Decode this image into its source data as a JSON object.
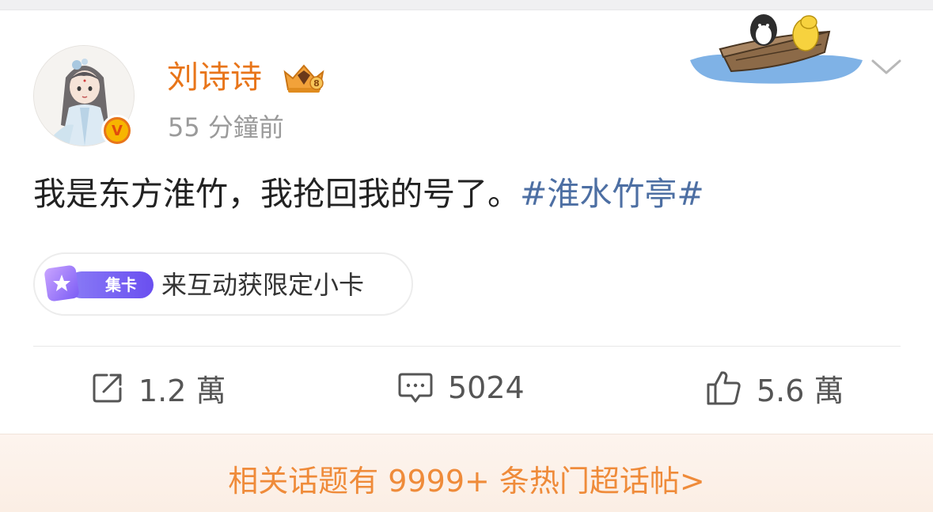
{
  "post": {
    "username": "刘诗诗",
    "time": "55 分鐘前",
    "content_text": "我是东方淮竹，我抢回我的号了。",
    "content_topic": "#淮水竹亭#",
    "verified_badge": "V"
  },
  "promo_pill": {
    "label": "集卡",
    "text": "来互动获限定小卡"
  },
  "actions": {
    "repost_count": "1.2 萬",
    "comment_count": "5024",
    "like_count": "5.6 萬"
  },
  "footer": {
    "text": "相关话题有 9999+ 条热门超话帖>"
  },
  "icons": {
    "repost": "share-box-arrow-icon",
    "comment": "comment-bubble-icon",
    "like": "thumbs-up-icon",
    "more": "chevron-down-icon",
    "crown": "crown-badge-icon"
  },
  "colors": {
    "accent_orange": "#e8751a",
    "topic_blue": "#4d6fa3",
    "footer_orange": "#ef8b3a",
    "pill_purple": "#7b5cf5"
  }
}
